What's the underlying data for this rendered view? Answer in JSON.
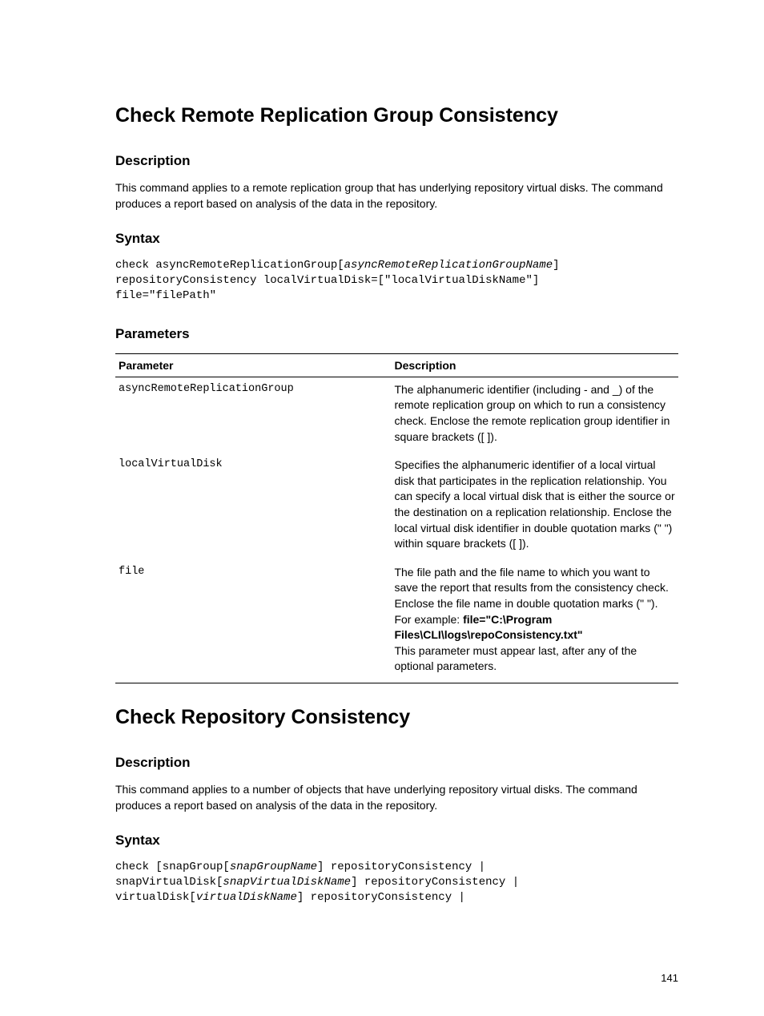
{
  "section1": {
    "title": "Check Remote Replication Group Consistency",
    "descHeading": "Description",
    "descText": "This command applies to a remote replication group that has underlying repository virtual disks. The command produces a report based on analysis of the data in the repository.",
    "syntaxHeading": "Syntax",
    "syntax": {
      "line1a": "check asyncRemoteReplicationGroup[",
      "line1b": "asyncRemoteReplicationGroupName",
      "line1c": "] ",
      "line2": "repositoryConsistency localVirtualDisk=[\"localVirtualDiskName\"] ",
      "line3": "file=\"filePath\""
    },
    "paramsHeading": "Parameters",
    "table": {
      "head1": "Parameter",
      "head2": "Description",
      "rows": [
        {
          "param": "asyncRemoteReplicationGroup",
          "desc": "The alphanumeric identifier (including - and _) of the remote replication group on which to run a consistency check. Enclose the remote replication group identifier in square brackets ([ ])."
        },
        {
          "param": "localVirtualDisk",
          "desc": "Specifies the alphanumeric identifier of a local virtual disk that participates in the replication relationship. You can specify a local virtual disk that is either the source or the destination on a replication relationship. Enclose the local virtual disk identifier in double quotation marks (\" \") within square brackets ([ ])."
        },
        {
          "param": "file",
          "descPre": "The file path and the file name to which you want to save the report that results from the consistency check. Enclose the file name in double quotation marks (\" \"). For example: ",
          "descBold": "file=\"C:\\Program Files\\CLI\\logs\\repoConsistency.txt\"",
          "descPost": "This parameter must appear last, after any of the optional parameters."
        }
      ]
    }
  },
  "section2": {
    "title": "Check Repository Consistency",
    "descHeading": "Description",
    "descText": "This command applies to a number of objects that have underlying repository virtual disks. The command produces a report based on analysis of the data in the repository.",
    "syntaxHeading": "Syntax",
    "syntax": {
      "l1a": "check [snapGroup[",
      "l1b": "snapGroupName",
      "l1c": "] repositoryConsistency |",
      "l2a": "snapVirtualDisk[",
      "l2b": "snapVirtualDiskName",
      "l2c": "] repositoryConsistency |",
      "l3a": "virtualDisk[",
      "l3b": "virtualDiskName",
      "l3c": "] repositoryConsistency |"
    }
  },
  "pageNumber": "141"
}
